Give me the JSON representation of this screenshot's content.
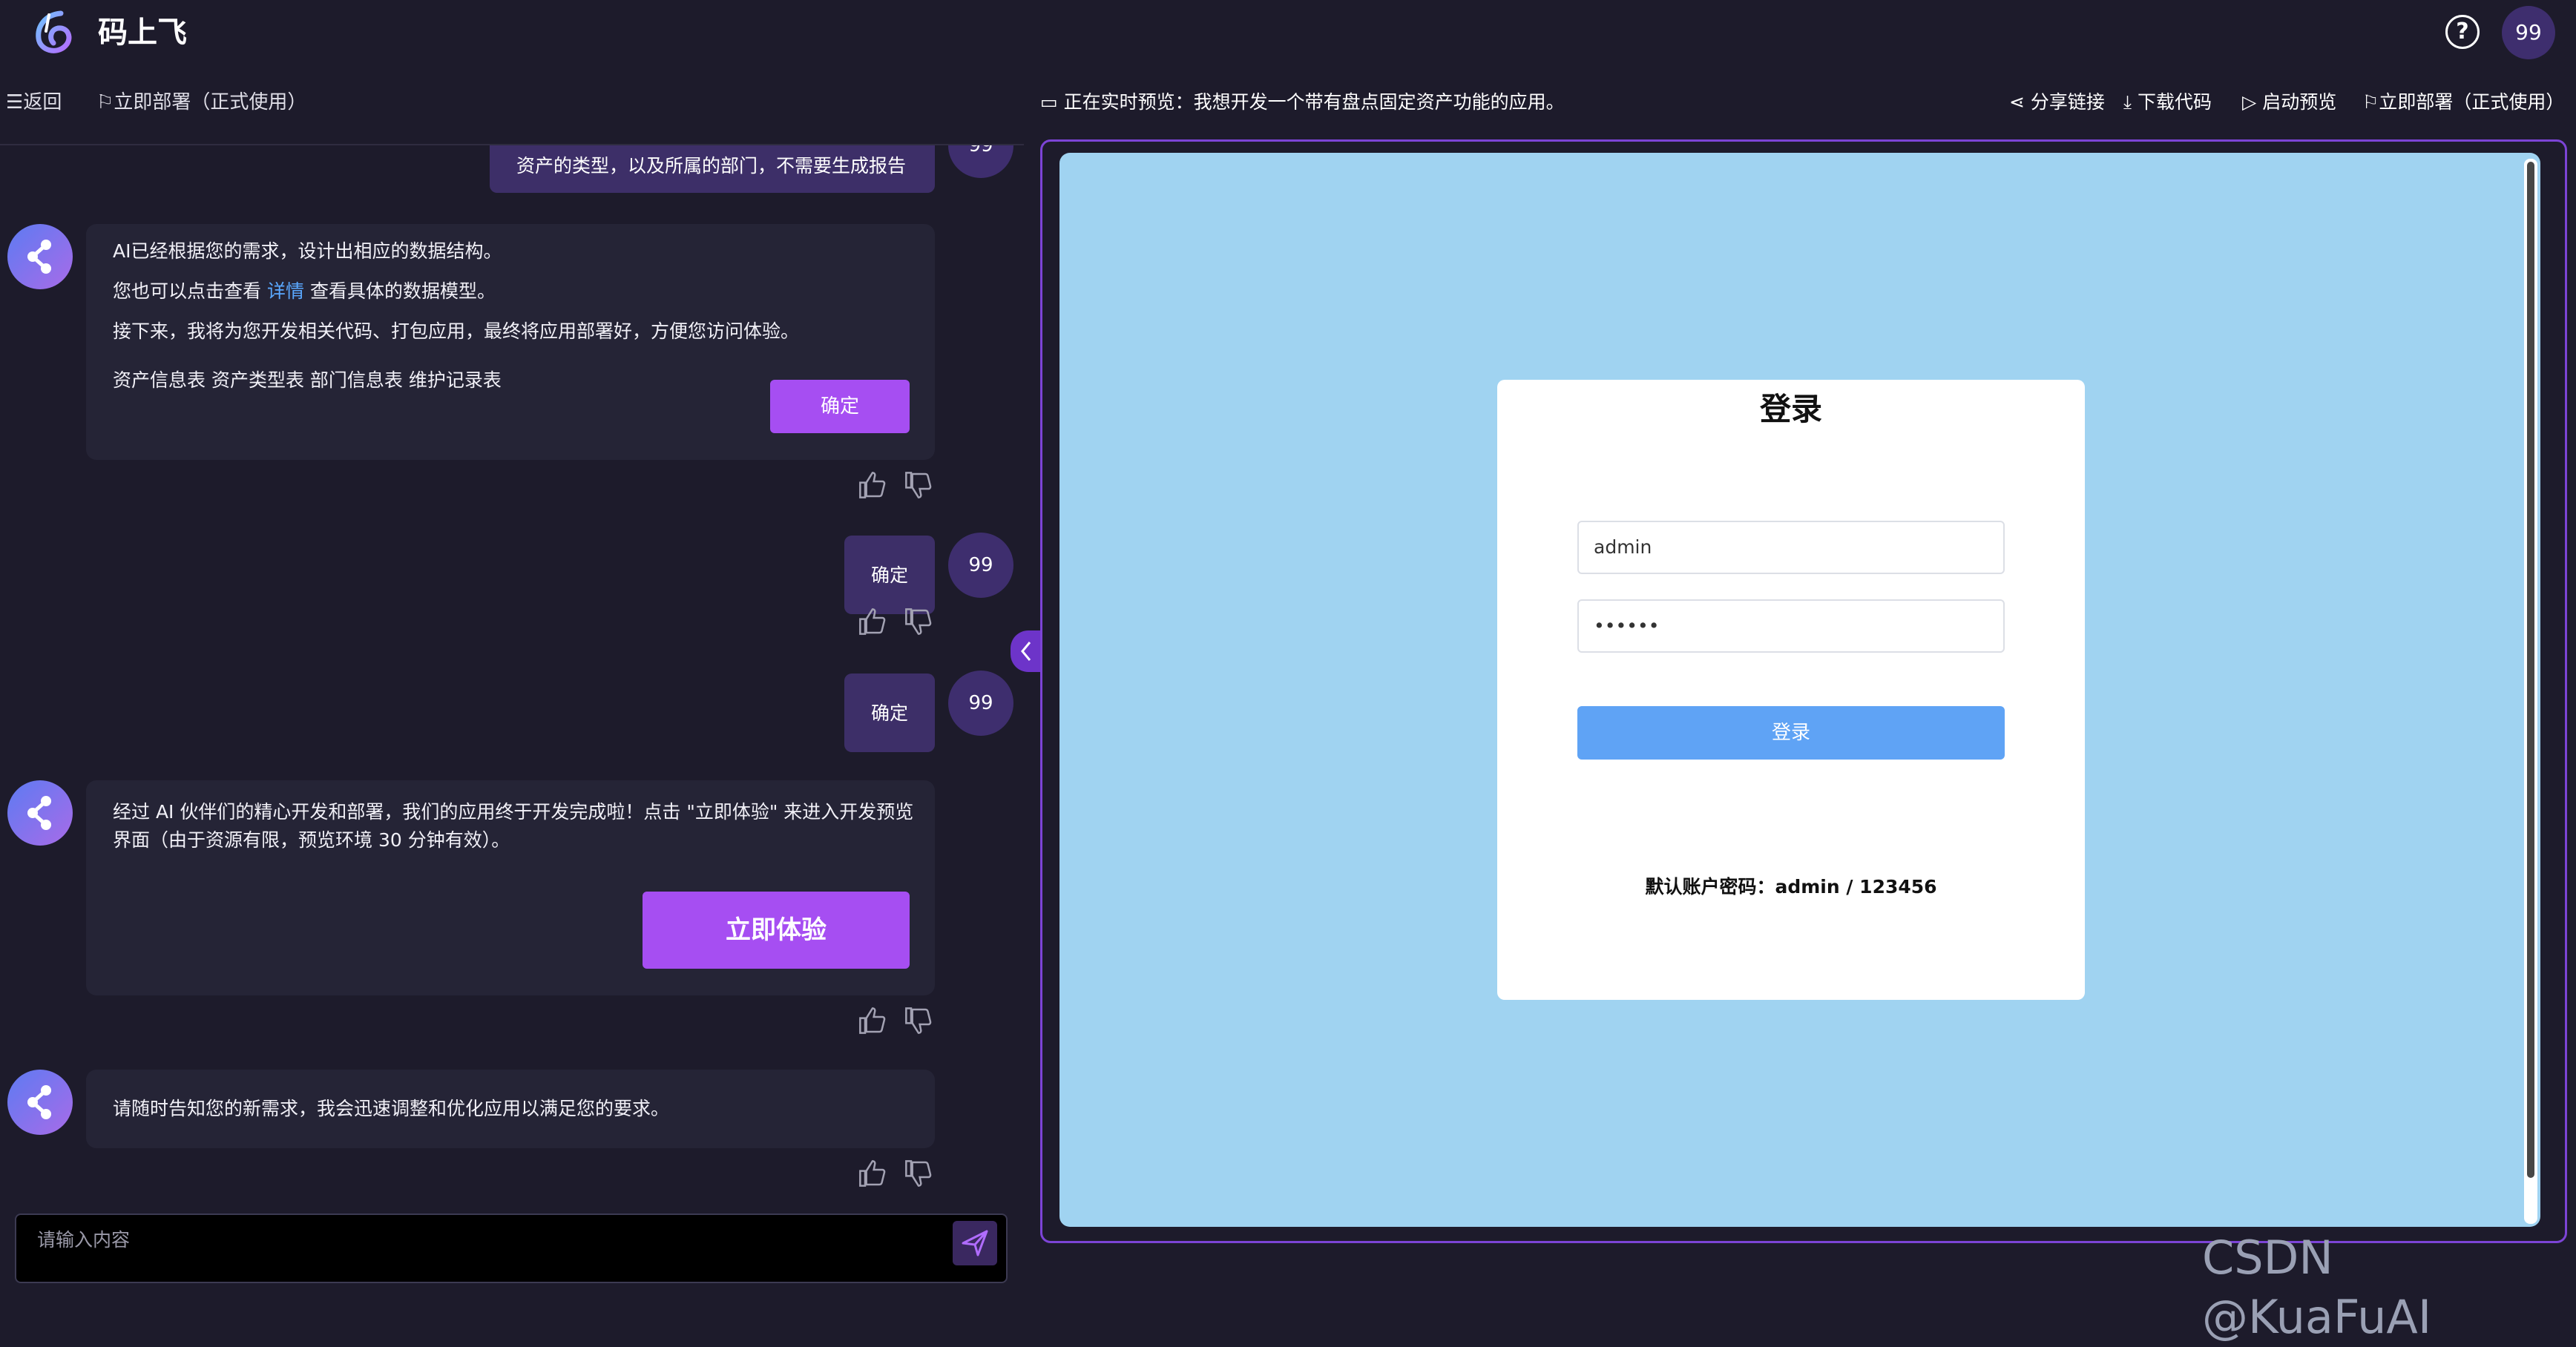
{
  "app": {
    "title": "码上飞",
    "help_icon": "?",
    "user_avatar": "99"
  },
  "left_toolbar": {
    "back": "返回",
    "deploy": "立即部署（正式使用）"
  },
  "chat": {
    "user_msg_1": "资产的类型，以及所属的部门，不需要生成报告",
    "user_avatar": "99",
    "ai_msg_1": {
      "line1": "AI已经根据您的需求，设计出相应的数据结构。",
      "line2_pre": "您也可以点击查看",
      "line2_link": "详情",
      "line2_post": "查看具体的数据模型。",
      "line3": "接下来，我将为您开发相关代码、打包应用，最终将应用部署好，方便您访问体验。",
      "tables": "资产信息表 资产类型表 部门信息表 维护记录表",
      "confirm": "确定"
    },
    "user_msg_2": "确定",
    "user_msg_3": "确定",
    "ai_msg_2": {
      "text": "经过 AI 伙伴们的精心开发和部署，我们的应用终于开发完成啦！点击 \"立即体验\" 来进入开发预览界面（由于资源有限，预览环境 30 分钟有效）。",
      "try_button": "立即体验"
    },
    "ai_msg_3": "请随时告知您的新需求，我会迅速调整和优化应用以满足您的要求。"
  },
  "input": {
    "placeholder": "请输入内容"
  },
  "preview_header": {
    "status": "正在实时预览：我想开发一个带有盘点固定资产功能的应用。",
    "share": "分享链接",
    "download": "下载代码",
    "launch": "启动预览",
    "deploy": "立即部署（正式使用）"
  },
  "login": {
    "title": "登录",
    "username": "admin",
    "password": "••••••",
    "button": "登录",
    "hint": "默认账户密码：admin / 123456"
  },
  "watermark": "CSDN @KuaFuAI",
  "colors": {
    "accent": "#a64ef2",
    "bg": "#1d1b2b",
    "preview_bg": "#a0d3f1",
    "login_btn": "#5fa3f5"
  }
}
